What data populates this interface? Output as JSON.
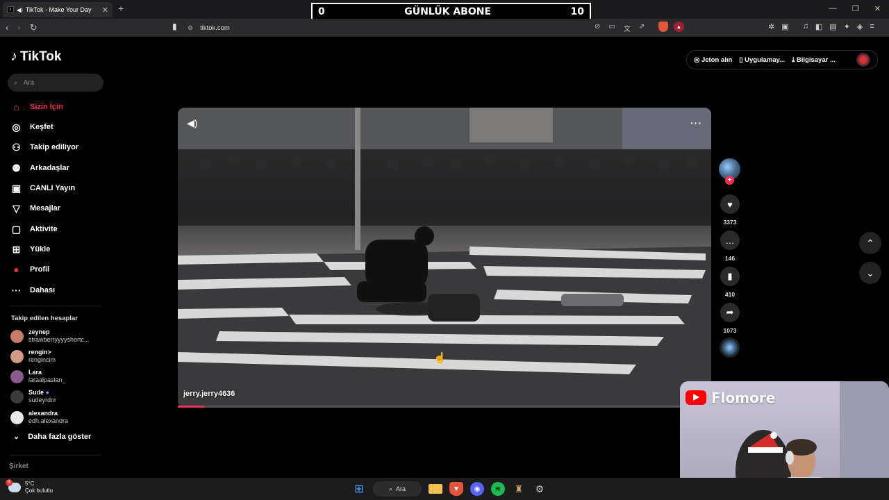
{
  "browser": {
    "tab_title": "TikTok - Make Your Day",
    "tab_close": "✕",
    "new_tab": "+",
    "url": "tiktok.com",
    "window_controls": [
      "—",
      "❐",
      "✕"
    ]
  },
  "overlay": {
    "left_count": "0",
    "title": "GÜNLÜK ABONE",
    "right_count": "10"
  },
  "sidebar": {
    "logo": "TikTok",
    "search_placeholder": "Ara",
    "nav": [
      {
        "label": "Sizin İçin",
        "icon": "home-icon",
        "active": true
      },
      {
        "label": "Keşfet",
        "icon": "compass-icon"
      },
      {
        "label": "Takip ediliyor",
        "icon": "following-icon"
      },
      {
        "label": "Arkadaşlar",
        "icon": "friends-icon"
      },
      {
        "label": "CANLI Yayın",
        "icon": "live-icon"
      },
      {
        "label": "Mesajlar",
        "icon": "messages-icon"
      },
      {
        "label": "Aktivite",
        "icon": "activity-icon"
      },
      {
        "label": "Yükle",
        "icon": "upload-icon"
      },
      {
        "label": "Profil",
        "icon": "profile-icon"
      },
      {
        "label": "Dahası",
        "icon": "more-icon"
      }
    ],
    "following_title": "Takip edilen hesaplar",
    "accounts": [
      {
        "name": "zeynep",
        "user": "strawberryyyyshortc...",
        "color": "#c97b6a"
      },
      {
        "name": "rengin>",
        "user": "rengincim",
        "color": "#d49a86"
      },
      {
        "name": "Lara",
        "user": "laraalpaslan_",
        "color": "#8a5a8c"
      },
      {
        "name": "Sude",
        "user": "sudeyrdnr",
        "color": "#3a3a3a"
      },
      {
        "name": "alexandra",
        "user": "edh.alexandra",
        "color": "#e8e8e8"
      }
    ],
    "show_more": "Daha fazla göster",
    "company": "Şirket"
  },
  "topright": {
    "coins": "Jeton alın",
    "app": "Uygulamay...",
    "desktop": "Bilgisayar ..."
  },
  "video": {
    "username": "jerry.jerry4636",
    "progress": 0.05
  },
  "actions": {
    "likes": "3373",
    "comments": "146",
    "saves": "410",
    "shares": "1073"
  },
  "webcam": {
    "channel": "Flomore"
  },
  "taskbar": {
    "temp": "5°C",
    "weather": "Çok bulutlu",
    "weather_badge": "3",
    "search": "Ara"
  },
  "colors": {
    "accent": "#fe2c55",
    "background": "#000000"
  }
}
